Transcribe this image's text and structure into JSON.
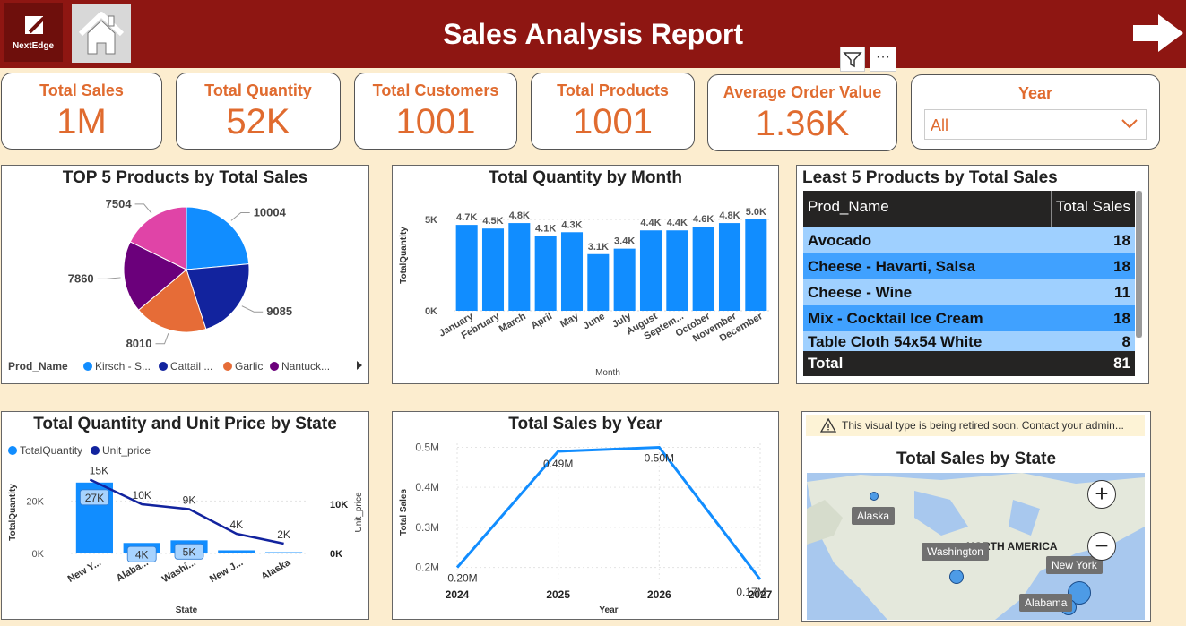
{
  "header": {
    "title": "Sales Analysis Report",
    "logo_text": "NextEdge",
    "icons": [
      "home-icon",
      "next-page-arrow-icon",
      "filter-icon",
      "more-options-icon"
    ],
    "colors": {
      "bar": "#8e1612",
      "background": "#fcedcf",
      "accent": "#e06b2f"
    }
  },
  "kpis": [
    {
      "label": "Total Sales",
      "value": "1M"
    },
    {
      "label": "Total Quantity",
      "value": "52K"
    },
    {
      "label": "Total Customers",
      "value": "1001"
    },
    {
      "label": "Total Products",
      "value": "1001"
    },
    {
      "label": "Average Order Value",
      "value": "1.36K"
    }
  ],
  "year_slicer": {
    "label": "Year",
    "value": "All"
  },
  "more_label": "···",
  "least5": {
    "title": "Least 5 Products by Total Sales",
    "columns": [
      "Prod_Name",
      "Total Sales"
    ],
    "rows": [
      {
        "name": "Avocado",
        "value": "18"
      },
      {
        "name": "Cheese - Havarti, Salsa",
        "value": "18"
      },
      {
        "name": "Cheese - Wine",
        "value": "11"
      },
      {
        "name": "Mix - Cocktail Ice Cream",
        "value": "18"
      },
      {
        "name": "Table Cloth 54x54 White",
        "value": "8"
      }
    ],
    "total_label": "Total",
    "total_value": "81"
  },
  "map_visual": {
    "warning": "This visual type is being retired soon. Contact your admin...",
    "title": "Total Sales by State",
    "region_label": "NORTH AMERICA",
    "state_labels": [
      "Alaska",
      "Washington",
      "New York",
      "Alabama"
    ],
    "zoom_in": "+",
    "zoom_out": "−"
  },
  "chart_data": [
    {
      "type": "pie",
      "title": "TOP 5 Products by Total Sales",
      "legend_title": "Prod_Name",
      "legend_labels": [
        "Kirsch - S...",
        "Cattail ...",
        "Garlic",
        "Nantuck..."
      ],
      "values": [
        10004,
        9085,
        8010,
        7860,
        7504
      ],
      "colors": [
        "#118dff",
        "#12239e",
        "#e66c37",
        "#6b007b",
        "#e044a7"
      ]
    },
    {
      "type": "bar",
      "title": "Total Quantity by Month",
      "xlabel": "Month",
      "ylabel": "TotalQuantity",
      "categories": [
        "January",
        "February",
        "March",
        "April",
        "May",
        "June",
        "July",
        "August",
        "Septem...",
        "October",
        "November",
        "December"
      ],
      "values": [
        4700,
        4500,
        4800,
        4100,
        4300,
        3100,
        3400,
        4400,
        4400,
        4600,
        4800,
        5000
      ],
      "data_labels": [
        "4.7K",
        "4.5K",
        "4.8K",
        "4.1K",
        "4.3K",
        "3.1K",
        "3.4K",
        "4.4K",
        "4.4K",
        "4.6K",
        "4.8K",
        "5.0K"
      ],
      "ytick_labels": [
        "0K",
        "5K"
      ],
      "ylim": [
        0,
        5000
      ]
    },
    {
      "type": "bar",
      "title": "Total Quantity and Unit Price by State",
      "xlabel": "State",
      "ylabel": "TotalQuantity",
      "y2label": "Unit_price",
      "categories": [
        "New Y...",
        "Alaba...",
        "Washi...",
        "New J...",
        "Alaska"
      ],
      "series": [
        {
          "name": "TotalQuantity",
          "values": [
            27000,
            4000,
            5000,
            1200,
            500
          ],
          "labels": [
            "27K",
            "4K",
            "5K",
            "",
            ""
          ]
        },
        {
          "name": "Unit_price",
          "values": [
            15000,
            10000,
            9000,
            4000,
            2000
          ],
          "labels": [
            "15K",
            "10K",
            "9K",
            "4K",
            "2K"
          ]
        }
      ],
      "ytick_labels": [
        "0K",
        "20K"
      ],
      "y2tick_labels": [
        "0K",
        "10K"
      ],
      "ylim": [
        0,
        30000
      ],
      "y2lim": [
        0,
        16000
      ]
    },
    {
      "type": "line",
      "title": "Total Sales by Year",
      "xlabel": "Year",
      "ylabel": "Total Sales",
      "x": [
        2024,
        2025,
        2026,
        2027
      ],
      "values": [
        0.2,
        0.49,
        0.5,
        0.17
      ],
      "data_labels": [
        "0.20M",
        "0.49M",
        "0.50M",
        "0.17M"
      ],
      "yticks": [
        0.2,
        0.3,
        0.4,
        0.5
      ],
      "ytick_labels": [
        "0.2M",
        "0.3M",
        "0.4M",
        "0.5M"
      ],
      "ylim": [
        0.17,
        0.51
      ]
    }
  ]
}
